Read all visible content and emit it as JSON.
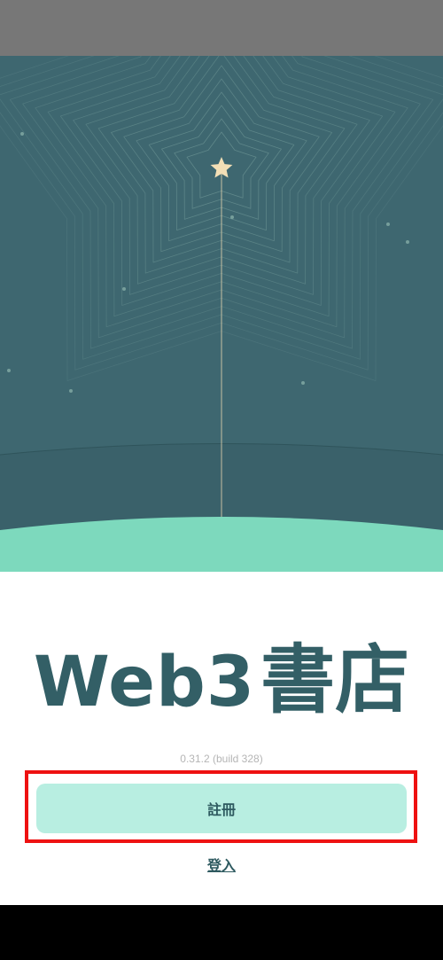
{
  "app": {
    "title_latin": "Web3",
    "title_cjk": "書店",
    "version": "0.31.2 (build 328)"
  },
  "actions": {
    "register_label": "註冊",
    "login_label": "登入"
  },
  "colors": {
    "sky": "#3e6770",
    "ground": "#7dd9bd",
    "title": "#335f66",
    "register_button_bg": "#b8eee1",
    "highlight": "#ee1111",
    "star": "#f3dfb6"
  },
  "icons": {
    "hero_star": "star-icon"
  }
}
